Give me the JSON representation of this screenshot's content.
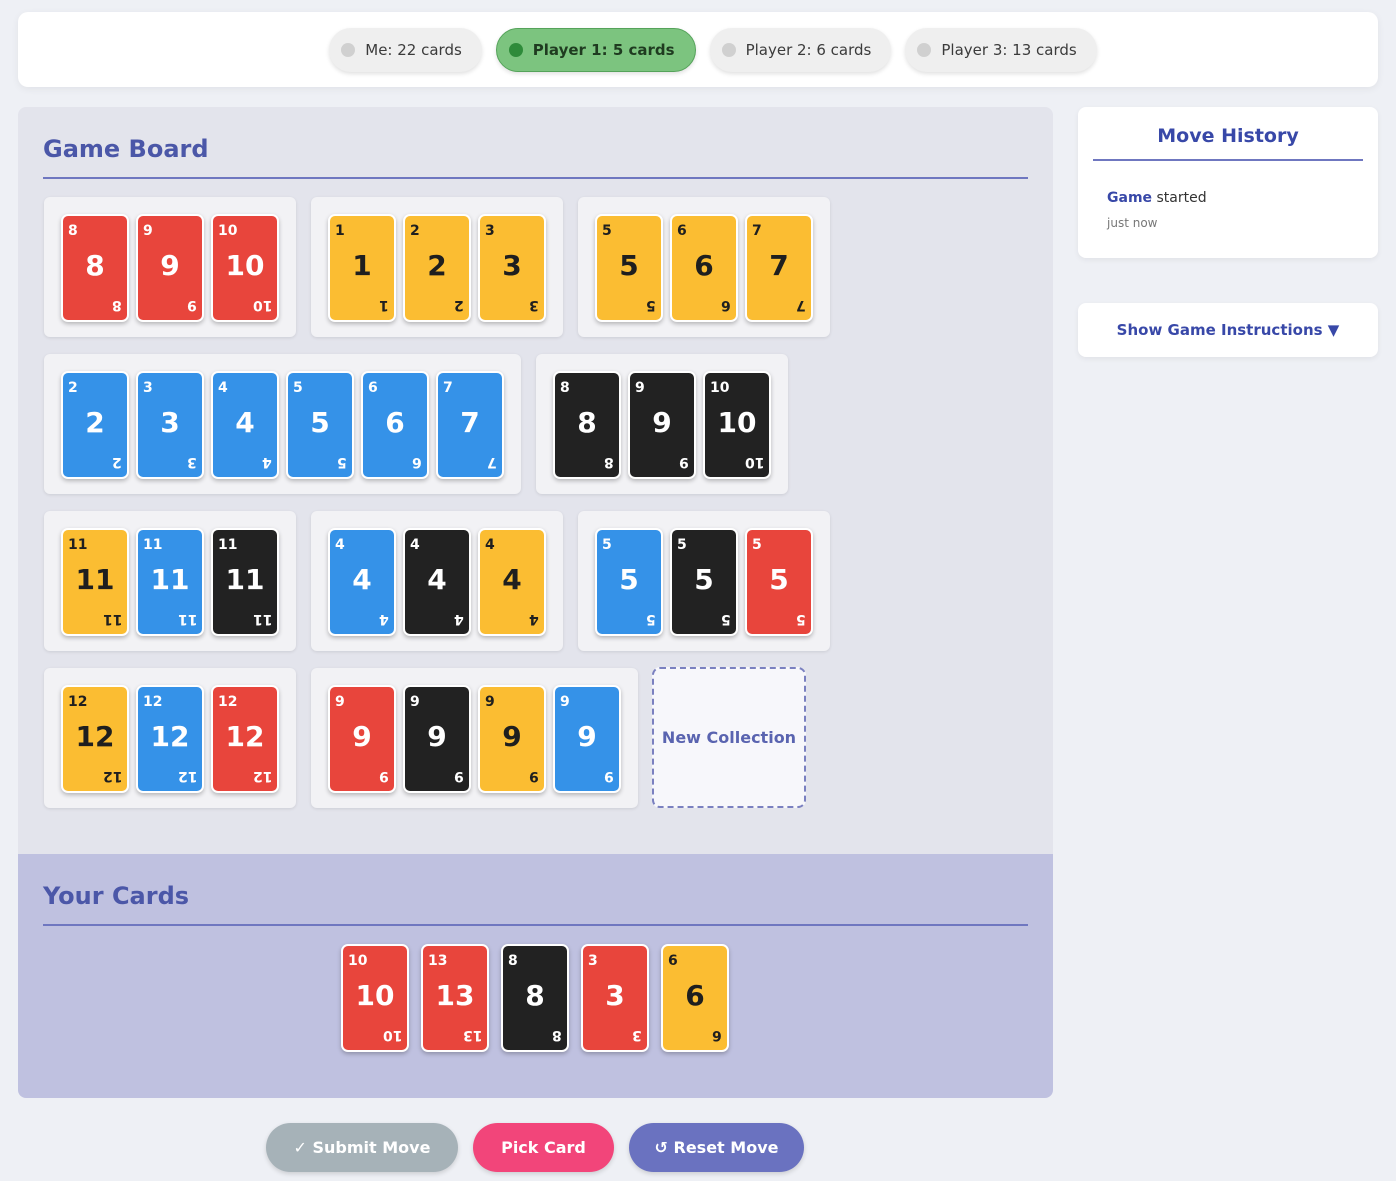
{
  "players": [
    {
      "label": "Me: 22 cards",
      "active": false
    },
    {
      "label": "Player 1: 5 cards",
      "active": true
    },
    {
      "label": "Player 2: 6 cards",
      "active": false
    },
    {
      "label": "Player 3: 13 cards",
      "active": false
    }
  ],
  "board": {
    "title": "Game Board",
    "new_collection_label": "New Collection",
    "collections": [
      [
        {
          "v": "8",
          "c": "red"
        },
        {
          "v": "9",
          "c": "red"
        },
        {
          "v": "10",
          "c": "red"
        }
      ],
      [
        {
          "v": "1",
          "c": "yellow"
        },
        {
          "v": "2",
          "c": "yellow"
        },
        {
          "v": "3",
          "c": "yellow"
        }
      ],
      [
        {
          "v": "5",
          "c": "yellow"
        },
        {
          "v": "6",
          "c": "yellow"
        },
        {
          "v": "7",
          "c": "yellow"
        }
      ],
      [
        {
          "v": "2",
          "c": "blue"
        },
        {
          "v": "3",
          "c": "blue"
        },
        {
          "v": "4",
          "c": "blue"
        },
        {
          "v": "5",
          "c": "blue"
        },
        {
          "v": "6",
          "c": "blue"
        },
        {
          "v": "7",
          "c": "blue"
        }
      ],
      [
        {
          "v": "8",
          "c": "black"
        },
        {
          "v": "9",
          "c": "black"
        },
        {
          "v": "10",
          "c": "black"
        }
      ],
      [
        {
          "v": "11",
          "c": "yellow"
        },
        {
          "v": "11",
          "c": "blue"
        },
        {
          "v": "11",
          "c": "black"
        }
      ],
      [
        {
          "v": "4",
          "c": "blue"
        },
        {
          "v": "4",
          "c": "black"
        },
        {
          "v": "4",
          "c": "yellow"
        }
      ],
      [
        {
          "v": "5",
          "c": "blue"
        },
        {
          "v": "5",
          "c": "black"
        },
        {
          "v": "5",
          "c": "red"
        }
      ],
      [
        {
          "v": "12",
          "c": "yellow"
        },
        {
          "v": "12",
          "c": "blue"
        },
        {
          "v": "12",
          "c": "red"
        }
      ],
      [
        {
          "v": "9",
          "c": "red"
        },
        {
          "v": "9",
          "c": "black"
        },
        {
          "v": "9",
          "c": "yellow"
        },
        {
          "v": "9",
          "c": "blue"
        }
      ]
    ]
  },
  "hand": {
    "title": "Your Cards",
    "cards": [
      {
        "v": "10",
        "c": "red"
      },
      {
        "v": "13",
        "c": "red"
      },
      {
        "v": "8",
        "c": "black"
      },
      {
        "v": "3",
        "c": "red"
      },
      {
        "v": "6",
        "c": "yellow"
      }
    ]
  },
  "history": {
    "title": "Move History",
    "entry_bold": "Game",
    "entry_rest": " started",
    "time": "just now"
  },
  "instructions": {
    "label": "Show Game Instructions ▼"
  },
  "actions": {
    "submit": "✓ Submit Move",
    "pick": "Pick Card",
    "reset": "↺ Reset Move"
  }
}
